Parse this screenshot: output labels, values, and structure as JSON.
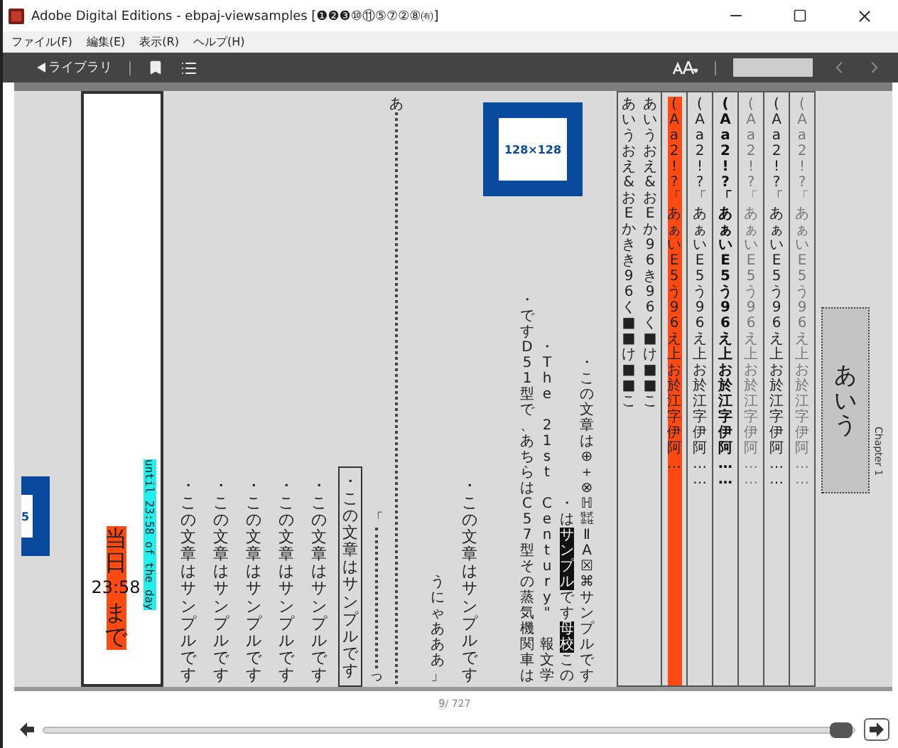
{
  "window": {
    "title": "Adobe Digital Editions - ebpaj-viewsamples [❶❷❸⑩⑪⑤⑦②⑧㈲]"
  },
  "menu": [
    "ファイル(F)",
    "編集(E)",
    "表示(R)",
    "ヘルプ(H)"
  ],
  "toolbar": {
    "library": "ライブラリ"
  },
  "columns": [
    {
      "kind": "picture_fragment",
      "text": "5"
    },
    {
      "kind": "deadline_box",
      "parts": [
        "当日",
        "23:58",
        "まで"
      ],
      "note": "until 23:58 of the day"
    },
    {
      "kind": "sentence",
      "text": "・この文章はサンプルです"
    },
    {
      "kind": "sentence",
      "text": "・この文章はサンプルです"
    },
    {
      "kind": "sentence",
      "text": "・この文章はサンプルです"
    },
    {
      "kind": "sentence",
      "text": "・この文章はサンプルです"
    },
    {
      "kind": "sentence",
      "text": "・この文章はサンプルです"
    },
    {
      "kind": "boxed_sentence",
      "text": "・この文章はサンプルです"
    },
    {
      "kind": "ellipsis_rule",
      "open": "「",
      "close": "っ"
    },
    {
      "kind": "dotted_rule",
      "text": "あ"
    },
    {
      "kind": "dialogue",
      "text": "うにゃあああ」"
    },
    {
      "kind": "sentence",
      "text": "・この文章はサンプルです"
    },
    {
      "kind": "figure_block",
      "picture_label": "128×128",
      "lines": [
        {
          "segments": [
            {
              "text": "・ですD51型で、あちらはC57型その蒸気機関車は",
              "inverse": false
            }
          ]
        },
        {
          "segments": [
            {
              "text": "・The 21st Century\" 報文学",
              "inverse": false
            }
          ]
        },
        {
          "segments": [
            {
              "text": "・は",
              "inverse": false
            },
            {
              "text": "サンプル",
              "inverse": true
            },
            {
              "text": "です",
              "inverse": false
            },
            {
              "text": "母校",
              "inverse": true
            },
            {
              "text": "この",
              "inverse": false
            }
          ]
        },
        {
          "segments": [
            {
              "text": "・この文章は⊕＋⊗ℍ㍿ⅡA☒⌘サンプルです",
              "inverse": false
            }
          ]
        }
      ]
    },
    {
      "kind": "sample_frame",
      "kana_lines": [
        "あいうおえ&おEかきき96く■■け■■こ",
        "あいうおえ&おEか96き96く■け■■こ"
      ],
      "samples": [
        {
          "text": "(Aa2!?「あぁいE5う96え上お於江字伊阿…",
          "kind": "plain",
          "highlighted": true
        },
        {
          "text": "(Aa2!?「あぁいE5う96え上お於江字伊阿……",
          "kind": "plain",
          "highlighted": false
        },
        {
          "text": "(Aa2!?「あぁいE5う96え上お於江字伊阿……",
          "kind": "bold",
          "highlighted": false
        },
        {
          "text": "(Aa2!?「あぁいE5う96え上お於江字伊阿……",
          "kind": "light",
          "highlighted": false
        },
        {
          "text": "(Aa2!?「あぁいE5う96え上お於江字伊阿……",
          "kind": "plain",
          "highlighted": false
        },
        {
          "text": "(Aa2!?「あぁいE5う96え上お於江字伊阿……",
          "kind": "light",
          "highlighted": false
        }
      ]
    },
    {
      "kind": "heading",
      "text": "あいう"
    },
    {
      "kind": "chapter",
      "text": "Chapter 1"
    }
  ],
  "footer": {
    "page": "9",
    "total": "/ 727",
    "level": 0.985
  }
}
